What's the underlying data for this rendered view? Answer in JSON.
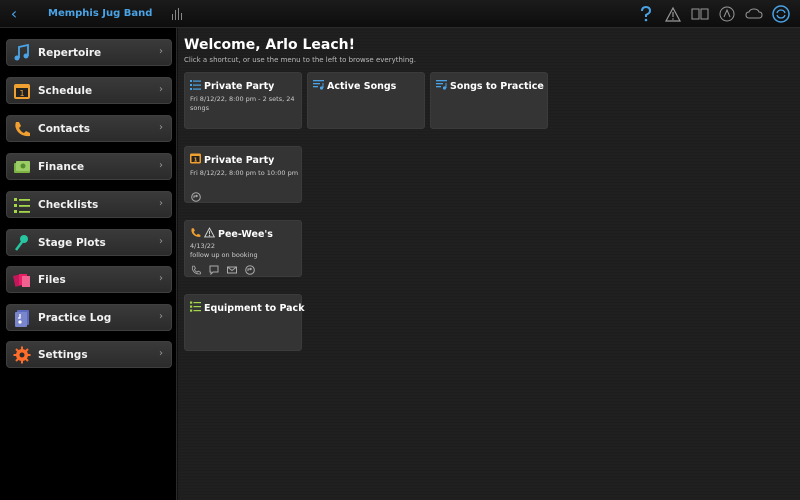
{
  "topbar": {
    "band_name": "Memphis Jug Band",
    "icons": [
      "back-chevron-icon",
      "audio-wave-icon",
      "help-icon",
      "warning-icon",
      "book-icon",
      "metronome-icon",
      "cloud-icon",
      "sync-icon"
    ]
  },
  "sidebar": {
    "items": [
      {
        "label": "Repertoire",
        "icon": "music-note-icon"
      },
      {
        "label": "Schedule",
        "icon": "calendar-icon"
      },
      {
        "label": "Contacts",
        "icon": "phone-icon"
      },
      {
        "label": "Finance",
        "icon": "money-icon"
      },
      {
        "label": "Checklists",
        "icon": "checklist-icon"
      },
      {
        "label": "Stage Plots",
        "icon": "microphone-icon"
      },
      {
        "label": "Files",
        "icon": "files-icon"
      },
      {
        "label": "Practice Log",
        "icon": "practice-log-icon"
      },
      {
        "label": "Settings",
        "icon": "gear-icon"
      }
    ]
  },
  "main": {
    "welcome": "Welcome, Arlo Leach!",
    "subtitle": "Click a shortcut, or use the menu to the left to browse everything.",
    "cards": [
      {
        "title": "Private Party",
        "detail": "Fri 8/12/22, 8:00 pm - 2 sets, 24 songs"
      },
      {
        "title": "Active Songs"
      },
      {
        "title": "Songs to Practice"
      },
      {
        "title": "Private Party",
        "detail": "Fri 8/12/22, 8:00 pm to 10:00 pm"
      },
      {
        "title": "Pee-Wee's",
        "detail_line1": "4/13/22",
        "detail_line2": "follow up on booking"
      },
      {
        "title": "Equipment to Pack"
      }
    ]
  },
  "colors": {
    "accent": "#4aa3e6",
    "gig_orange": "#f0a030",
    "list_blue": "#4aa3e6",
    "check_green": "#a4d64a"
  }
}
